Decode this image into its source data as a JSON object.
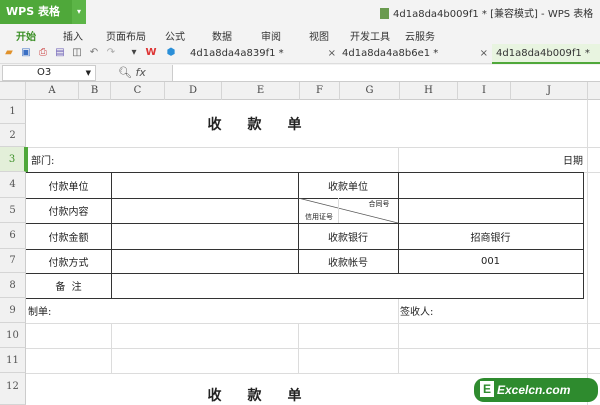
{
  "app": {
    "logo": "WPS 表格",
    "window_title": "4d1a8da4b009f1 * [兼容模式] - WPS 表格"
  },
  "menu": [
    "开始",
    "插入",
    "页面布局",
    "公式",
    "数据",
    "审阅",
    "视图",
    "开发工具",
    "云服务"
  ],
  "tabs": [
    {
      "label": "4d1a8da4a839f1 *"
    },
    {
      "label": "4d1a8da4a8b6e1 *"
    },
    {
      "label": "4d1a8da4b009f1 *"
    }
  ],
  "formula": {
    "name_box": "O3",
    "fx": "fx",
    "value": ""
  },
  "columns": [
    "A",
    "B",
    "C",
    "D",
    "E",
    "F",
    "G",
    "H",
    "I",
    "J"
  ],
  "rows": [
    "1",
    "2",
    "3",
    "4",
    "5",
    "6",
    "7",
    "8",
    "9",
    "10",
    "11",
    "12"
  ],
  "sheet": {
    "title": "收款单",
    "dept": "部门:",
    "date": "日期",
    "pay_unit": "付款单位",
    "pay_content": "付款内容",
    "pay_amount": "付款金额",
    "pay_method": "付款方式",
    "remark": "备  注",
    "recv_unit": "收款单位",
    "contract_no": "合同号",
    "credit_no": "信用证号",
    "recv_bank": "收款银行",
    "recv_account": "收款帐号",
    "bank_value": "招商银行",
    "account_value": "001",
    "maker": "制单:",
    "receiver": "签收人:"
  },
  "watermark": "Excelcn.com",
  "colors": {
    "accent": "#4fa83a"
  }
}
